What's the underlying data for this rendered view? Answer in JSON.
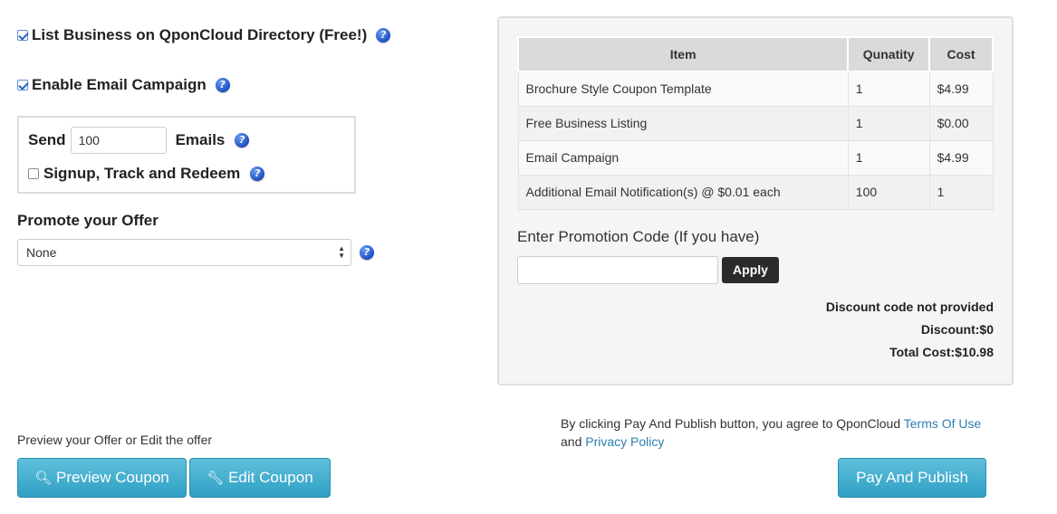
{
  "options": {
    "list_business": {
      "label": "List Business on QponCloud Directory (Free!)",
      "checked": true
    },
    "email_campaign": {
      "label": "Enable Email Campaign",
      "checked": true
    },
    "send": {
      "label": "Send",
      "value": "100",
      "suffix": "Emails"
    },
    "signup": {
      "label": "Signup, Track and Redeem",
      "checked": false
    },
    "promote": {
      "label": "Promote your Offer",
      "selected": "None"
    }
  },
  "help_icon_glyph": "?",
  "cart": {
    "headers": [
      "Item",
      "Qunatity",
      "Cost"
    ],
    "rows": [
      {
        "item": "Brochure Style Coupon Template",
        "qty": "1",
        "cost": "$4.99"
      },
      {
        "item": "Free Business Listing",
        "qty": "1",
        "cost": "$0.00"
      },
      {
        "item": "Email Campaign",
        "qty": "1",
        "cost": "$4.99"
      },
      {
        "item": "Additional Email Notification(s) @ $0.01 each",
        "qty": "100",
        "cost": "1"
      }
    ]
  },
  "promo": {
    "label": "Enter Promotion Code (If you have)",
    "value": "",
    "apply_label": "Apply"
  },
  "totals": {
    "discount_status": "Discount code not provided",
    "discount": "Discount:$0",
    "total": "Total Cost:$10.98"
  },
  "footer": {
    "preview_text": "Preview your Offer or Edit the offer",
    "preview_button": "Preview Coupon",
    "edit_button": "Edit Coupon",
    "agree_prefix": "By clicking Pay And Publish button, you agree to QponCloud ",
    "terms_link": "Terms Of Use",
    "and_text": "and ",
    "privacy_link": "Privacy Policy",
    "pay_button": "Pay And Publish"
  },
  "colors": {
    "accent_button": "#3aa7cc",
    "link": "#2a7fb0",
    "apply_button": "#2b2b2b",
    "help_icon": "#1d4fc4"
  }
}
